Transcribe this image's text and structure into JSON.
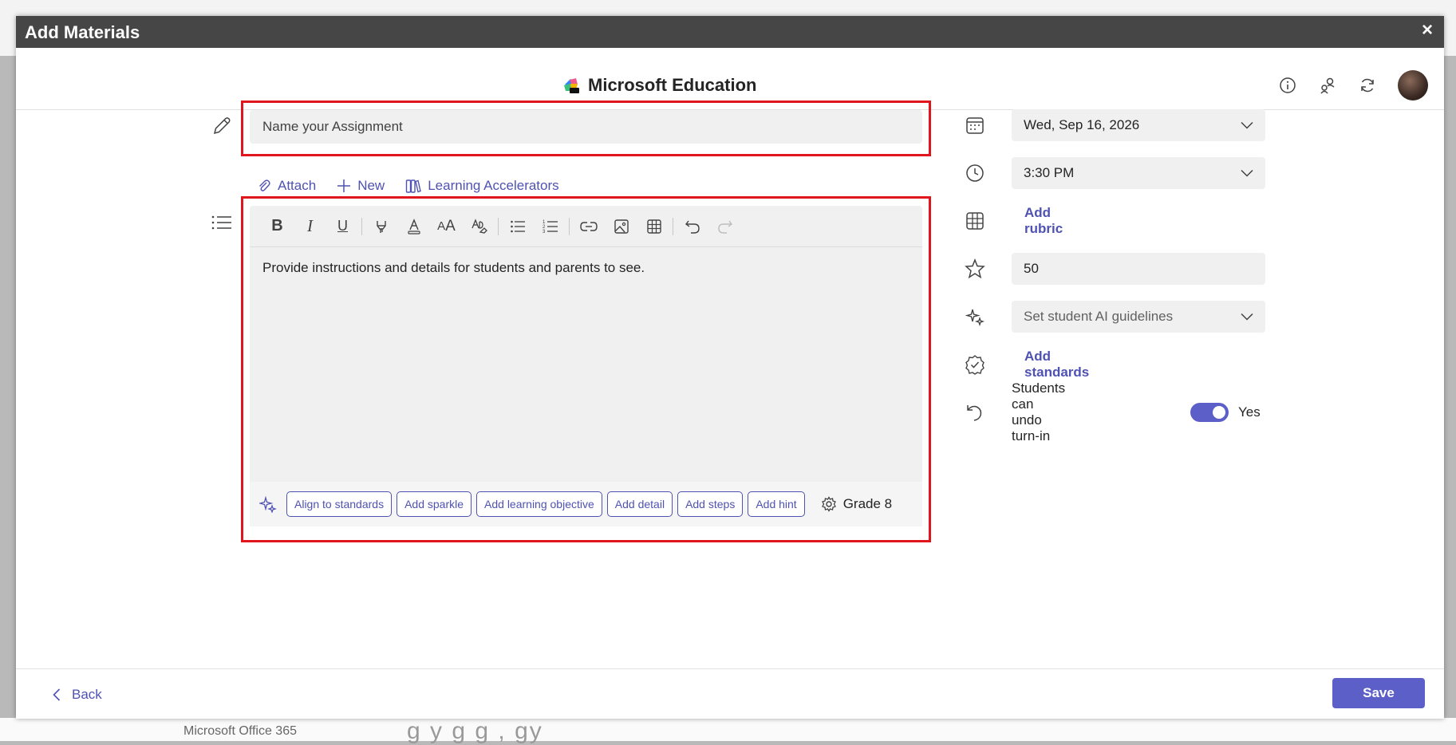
{
  "window": {
    "title": "Add Materials",
    "close_label": "×"
  },
  "app": {
    "brand": "Microsoft Education"
  },
  "assignment": {
    "name_placeholder": "Name your Assignment"
  },
  "attach_actions": [
    {
      "label": "Attach",
      "icon": "paperclip-icon"
    },
    {
      "label": "New",
      "icon": "plus-icon"
    },
    {
      "label": "Learning Accelerators",
      "icon": "books-icon"
    }
  ],
  "editor": {
    "placeholder_text": "Provide instructions and details for students and parents to see.",
    "toolbar": [
      "bold",
      "italic",
      "underline",
      "highlight",
      "font-color",
      "font-size",
      "clear-formatting",
      "bulleted-list",
      "numbered-list",
      "link",
      "image",
      "table",
      "undo",
      "redo"
    ]
  },
  "ai_chips": [
    "Align to standards",
    "Add sparkle",
    "Add learning objective",
    "Add detail",
    "Add steps",
    "Add hint"
  ],
  "grade_label": "Grade 8",
  "details": {
    "due_date": "Wed, Sep 16, 2026",
    "due_time": "3:30 PM",
    "rubric_link": "Add rubric",
    "points": "50",
    "ai_guidelines_placeholder": "Set student AI guidelines",
    "standards_link": "Add standards",
    "undo_turnin_label": "Students can undo turn-in",
    "undo_turnin_value": "Yes"
  },
  "footer": {
    "back_label": "Back",
    "save_label": "Save"
  },
  "background": {
    "left_text": "Microsoft Office 365",
    "blurred_text": "g          y g g ,       gy"
  },
  "colors": {
    "accent": "#5b5fc7",
    "link": "#4f52b2",
    "highlight_border": "#e0151e",
    "titlebar": "#464646"
  }
}
